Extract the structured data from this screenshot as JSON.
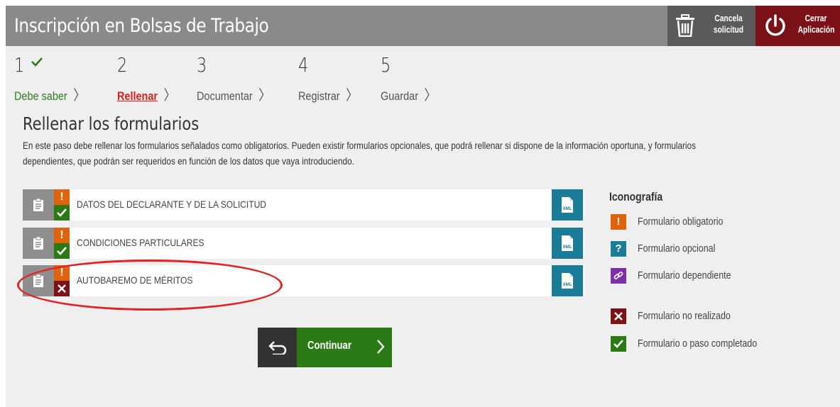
{
  "header": {
    "title": "Inscripción en Bolsas de Trabajo",
    "cancel_label_1": "Cancela",
    "cancel_label_2": "solicitud",
    "close_label_1": "Cerrar",
    "close_label_2": "Aplicación"
  },
  "steps": [
    {
      "num": "1",
      "label": "Debe saber",
      "state": "done"
    },
    {
      "num": "2",
      "label": "Rellenar",
      "state": "active"
    },
    {
      "num": "3",
      "label": "Documentar",
      "state": "pending"
    },
    {
      "num": "4",
      "label": "Registrar",
      "state": "pending"
    },
    {
      "num": "5",
      "label": "Guardar",
      "state": "pending"
    }
  ],
  "section": {
    "title": "Rellenar los formularios",
    "intro_1": "En este paso debe rellenar los formularios señalados como obligatorios. Pueden existir formularios opcionales, que podrá rellenar si dispone de la información oportuna, y formularios",
    "intro_2": "dependientes, que podrán ser requeridos en función de los datos que vaya introduciendo."
  },
  "forms": [
    {
      "name": "DATOS DEL DECLARANTE Y DE LA SOLICITUD",
      "mandatory_mark": "!",
      "status": "completed"
    },
    {
      "name": "CONDICIONES PARTICULARES",
      "mandatory_mark": "!",
      "status": "completed"
    },
    {
      "name": "AUTOBAREMO DE MÉRITOS",
      "mandatory_mark": "!",
      "status": "not-done"
    }
  ],
  "legend": {
    "title": "Iconografía",
    "items": [
      {
        "icon": "exclamation-icon",
        "symbol": "!",
        "color": "#e0620a",
        "label": "Formulario obligatorio"
      },
      {
        "icon": "question-icon",
        "symbol": "?",
        "color": "#1a7c96",
        "label": "Formulario opcional"
      },
      {
        "icon": "link-icon",
        "symbol": "",
        "color": "#7b2fa8",
        "label": "Formulario dependiente"
      },
      {
        "icon": "cross-icon",
        "symbol": "",
        "color": "#7a1218",
        "label": "Formulario no realizado"
      },
      {
        "icon": "check-icon",
        "symbol": "",
        "color": "#2b7a16",
        "label": "Formulario o paso completado"
      }
    ]
  },
  "actions": {
    "continue_label": "Continuar"
  },
  "colors": {
    "header_bg": "#8a8a8a",
    "cancel_bg": "#5b5b5b",
    "close_bg": "#7a1218",
    "mandatory": "#e0620a",
    "completed": "#2b7a16",
    "not_done": "#7a1218",
    "xml": "#1a7c96",
    "active_step": "#d4201c"
  }
}
